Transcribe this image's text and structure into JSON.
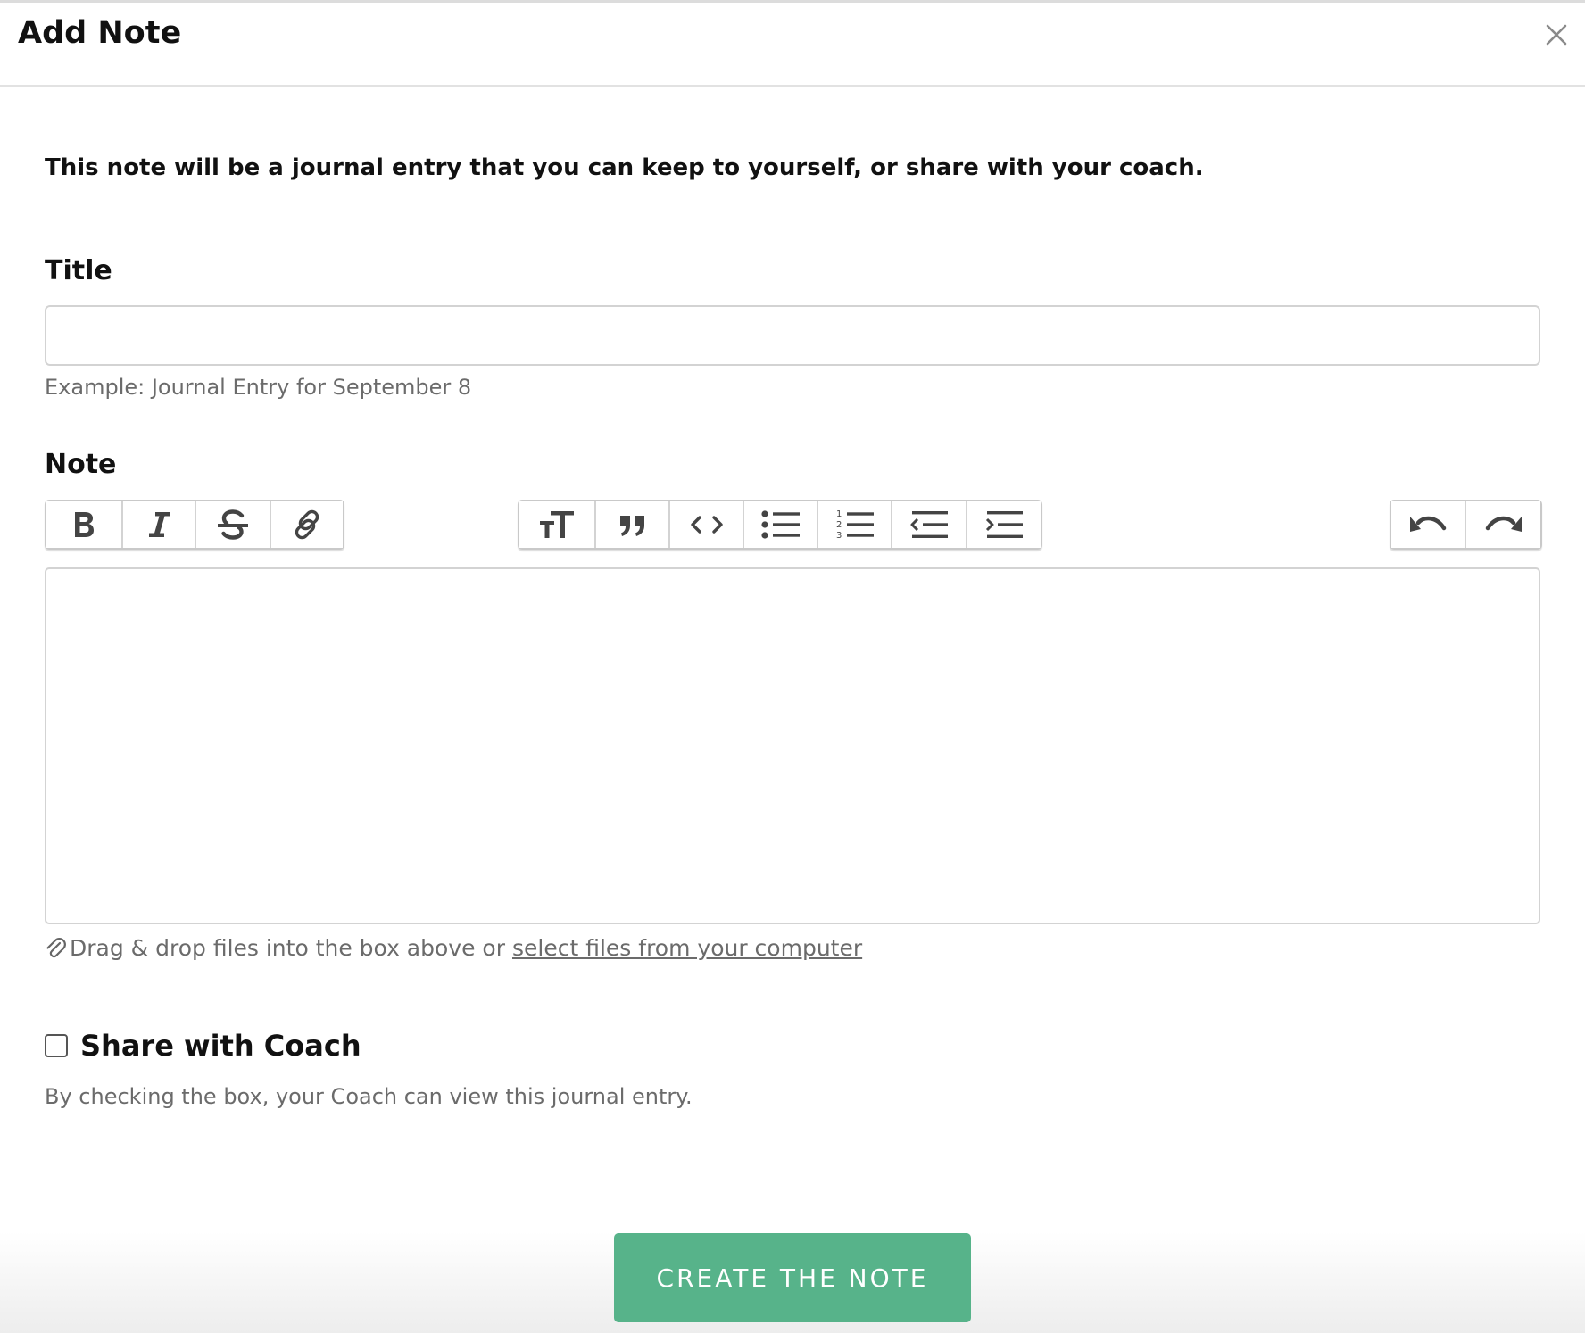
{
  "dialog": {
    "title": "Add Note",
    "intro": "This note will be a journal entry that you can keep to yourself, or share with your coach."
  },
  "title_field": {
    "label": "Title",
    "value": "",
    "hint": "Example: Journal Entry for September 8"
  },
  "note_field": {
    "label": "Note",
    "toolbar": {
      "format_group": [
        {
          "icon": "bold-icon"
        },
        {
          "icon": "italic-icon"
        },
        {
          "icon": "strikethrough-icon"
        },
        {
          "icon": "link-icon"
        }
      ],
      "block_group": [
        {
          "icon": "heading-icon"
        },
        {
          "icon": "quote-icon"
        },
        {
          "icon": "code-icon"
        },
        {
          "icon": "bullet-list-icon"
        },
        {
          "icon": "numbered-list-icon"
        },
        {
          "icon": "outdent-icon"
        },
        {
          "icon": "indent-icon"
        }
      ],
      "history_group": [
        {
          "icon": "undo-icon"
        },
        {
          "icon": "redo-icon"
        }
      ]
    },
    "content": ""
  },
  "attachments": {
    "icon": "paperclip-icon",
    "text": "Drag & drop files into the box above or",
    "link": "select files from your computer"
  },
  "share": {
    "label": "Share with Coach",
    "checked": false,
    "hint": "By checking the box, your Coach can view this journal entry."
  },
  "actions": {
    "submit_label": "CREATE THE NOTE"
  },
  "colors": {
    "primary": "#57b38a",
    "muted_text": "#6b6b6b",
    "border": "#d3d3d3"
  }
}
